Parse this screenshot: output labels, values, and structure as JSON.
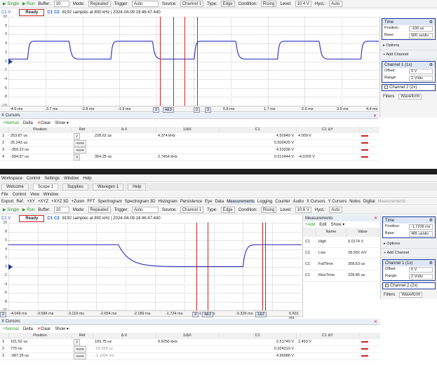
{
  "toolbar": {
    "single": "Single",
    "run": "Run",
    "buffer_label": "Buffer:",
    "buffer_value": "10",
    "mode_label": "Mode:",
    "mode_value": "Repeated",
    "trigger_label": "Trigger:",
    "trigger_value": "Auto",
    "source_label": "Source:",
    "source_value": "Channel 1",
    "type_label": "Type:",
    "type_value": "Edge",
    "condition_label": "Condition:",
    "condition_value": "Rising",
    "level_label": "Level:",
    "hyst_label": "Hyst.:",
    "hyst_value": "Auto"
  },
  "status": {
    "channel_tag": "C1 V",
    "ready": "Ready",
    "c1": "C1",
    "c2": "C2"
  },
  "top": {
    "level_value": "10.4 V",
    "info": "8192 samples at 800 kHz | 2024-04-09 18:46:47.440",
    "y_labels": [
      "10",
      "8",
      "6",
      "4",
      "2",
      "0",
      "-2",
      "-4",
      "-6",
      "-8",
      "-10"
    ],
    "x_labels": [
      "-4.6 ms",
      "-3.7 ms",
      "-2.8 ms",
      "-1.9 ms",
      "0.8 ms",
      "1.7 ms",
      "2.6 ms",
      "3.5 ms",
      "4.4 ms"
    ],
    "cursor_tags": [
      "3",
      "4&3",
      "2",
      "3"
    ],
    "time": {
      "title": "Time",
      "position_label": "Position:",
      "position": "-100 us",
      "base_label": "Base:",
      "base": "900 us/div"
    },
    "options": "Options",
    "add_channel": "Add Channel",
    "ch1": {
      "title": "Channel 1 (1x)",
      "offset_label": "Offset:",
      "offset": "0 V",
      "range_label": "Range:",
      "range": "2 V/div"
    },
    "ch2": "Channel 2 (2x)",
    "filters": "Filters",
    "waveform": "Waveform",
    "cursors_title": "X Cursors",
    "cursor_toolbar": [
      "Normal",
      "Delta",
      "Clear",
      "Show"
    ],
    "columns": [
      "Position",
      "Ref",
      "Δ X",
      "1/ΔX",
      "C1",
      "C1 ΔY"
    ],
    "rows": [
      {
        "n": "1",
        "pos": "253.87 us",
        "ref": "2",
        "dx": "228.62 us",
        "inv": "4.374 kHz",
        "c1": "4.50949 V",
        "dy": "4.009 V"
      },
      {
        "n": "2",
        "pos": "25.243 us",
        "ref": "none",
        "dx": "",
        "inv": "",
        "c1": "0.500425 V",
        "dy": ""
      },
      {
        "n": "3",
        "pos": "-359.22 us",
        "ref": "none",
        "dx": "",
        "inv": "",
        "c1": "4.53338 V",
        "dy": ""
      },
      {
        "n": "4",
        "pos": "-594.97 us",
        "ref": "3",
        "dx": "364.25 us",
        "inv": "2.7454 kHz",
        "c1": "0.512444 V",
        "dy": "-4.0209 V"
      }
    ]
  },
  "bottom": {
    "menu": [
      "Workspace",
      "Control",
      "Settings",
      "Window",
      "Help"
    ],
    "tabs": [
      "Welcome",
      "Scope 1",
      "Supplies",
      "Wavegen 1",
      "Help"
    ],
    "menu2": [
      "File",
      "Control",
      "View",
      "Window"
    ],
    "tools": [
      "Export",
      "Ref.",
      "+XY",
      "+XYZ",
      "+XYZ 3D",
      "+Zoom",
      "FFT",
      "Spectrogram",
      "Spectrogram 3D",
      "Histogram",
      "Persistence",
      "Eye",
      "Data",
      "Measurements",
      "Logging",
      "Counter",
      "Audio",
      "X Cursors",
      "Y Cursors",
      "Notes",
      "Digital",
      "Measurements"
    ],
    "level_value": "10.6 V",
    "info": "8192 samples at 800 kHz | 2024-04-09 18:46:47.440",
    "y_labels": [
      "10",
      "8",
      "6",
      "4",
      "2",
      "0",
      "-2",
      "-4",
      "-6",
      "-8",
      "-10"
    ],
    "x_labels": [
      "-4.049 ms",
      "-3.584 ms",
      "-3.119 ms",
      "-2.654 ms",
      "-2.189 ms",
      "-1.724 ms",
      "-1.259 ms",
      "-0.329 ms",
      "0.601 ms"
    ],
    "cursor_tags": [
      "3",
      "4&3",
      "2",
      "1&2"
    ],
    "measurements": {
      "title": "Measurements",
      "toolbar": [
        "Add",
        "Edit",
        "Show"
      ],
      "columns": [
        "Name",
        "Value"
      ],
      "rows": [
        {
          "ch": "C1",
          "name": "High",
          "value": "5.0174 V"
        },
        {
          "ch": "C1",
          "name": "Low",
          "value": "28.932 mV"
        },
        {
          "ch": "C1",
          "name": "FallTime",
          "value": "358.63 us"
        },
        {
          "ch": "C1",
          "name": "RiseTime",
          "value": "228.85 us"
        }
      ]
    },
    "time": {
      "title": "Time",
      "position_label": "Position:",
      "position": "-1.7236 ms",
      "base_label": "Base:",
      "base": "465 us/div"
    },
    "options": "Options",
    "add_channel": "Add Channel",
    "ch1": {
      "title": "Channel 1 (1x)",
      "offset_label": "Offset:",
      "offset": "0 V",
      "range_label": "Range:",
      "range": "2 V/div"
    },
    "ch2": "Channel 2 (2x)",
    "filters": "Filters",
    "waveform": "Waveform",
    "cursors_title": "X Cursors",
    "cursor_toolbar": [
      "Normal",
      "Delta",
      "Clear",
      "Show"
    ],
    "columns": [
      "Position",
      "Ref",
      "Δ X",
      "1/ΔX",
      "C1",
      "C1 ΔY"
    ],
    "rows": [
      {
        "n": "1",
        "pos": "101.52 us",
        "ref": "2",
        "dx": "100.75 us",
        "inv": "9.9256 kHz",
        "c1": "2.51749 V",
        "dy": "2.493 V"
      },
      {
        "n": "2",
        "pos": "775 ns",
        "ref": "none",
        "dx": "-93.058 us",
        "inv": "",
        "c1": "0.024319 V",
        "dy": ""
      },
      {
        "n": "3",
        "pos": "-987.35 us",
        "ref": "none",
        "dx": "-1.1004 ms",
        "inv": "",
        "c1": "4.96588 V",
        "dy": ""
      }
    ]
  },
  "colors": {
    "trace": "#3b3bbf",
    "cursor": "#c22222",
    "accent": "#1a3aa0"
  }
}
